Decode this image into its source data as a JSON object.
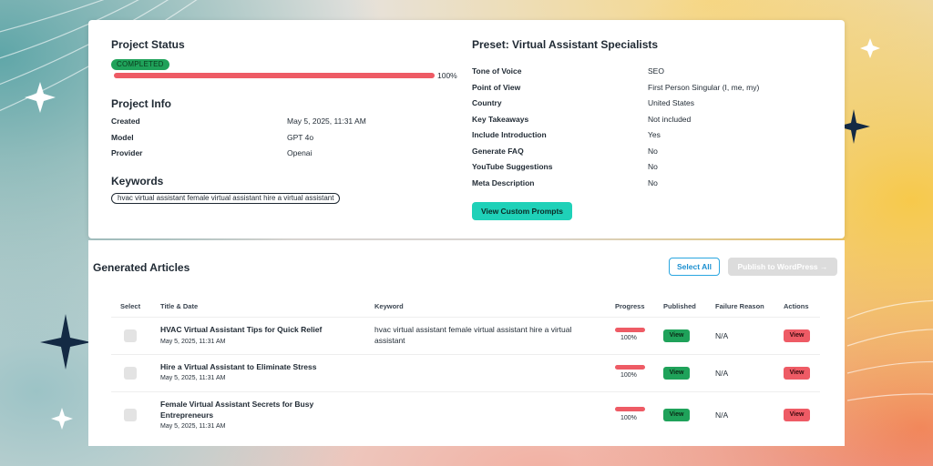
{
  "project_status": {
    "heading": "Project Status",
    "status_badge": "COMPLETED",
    "progress": 100,
    "progress_label": "100%"
  },
  "project_info": {
    "heading": "Project Info",
    "rows": [
      {
        "label": "Created",
        "value": "May 5, 2025, 11:31 AM"
      },
      {
        "label": "Model",
        "value": "GPT 4o"
      },
      {
        "label": "Provider",
        "value": "Openai"
      }
    ]
  },
  "keywords": {
    "heading": "Keywords",
    "items": [
      "hvac virtual assistant female virtual assistant hire a virtual assistant"
    ]
  },
  "preset": {
    "heading": "Preset: Virtual Assistant Specialists",
    "rows": [
      {
        "label": "Tone of Voice",
        "value": "SEO"
      },
      {
        "label": "Point of View",
        "value": "First Person Singular (I, me, my)"
      },
      {
        "label": "Country",
        "value": "United States"
      },
      {
        "label": "Key Takeaways",
        "value": "Not included"
      },
      {
        "label": "Include Introduction",
        "value": "Yes"
      },
      {
        "label": "Generate FAQ",
        "value": "No"
      },
      {
        "label": "YouTube Suggestions",
        "value": "No"
      },
      {
        "label": "Meta Description",
        "value": "No"
      }
    ],
    "custom_prompts_button": "View Custom Prompts"
  },
  "articles": {
    "heading": "Generated Articles",
    "select_all_button": "Select All",
    "publish_button": "Publish to WordPress →",
    "columns": [
      "Select",
      "Title & Date",
      "Keyword",
      "Progress",
      "Published",
      "Failure Reason",
      "Actions"
    ],
    "rows": [
      {
        "title": "HVAC Virtual Assistant Tips for Quick Relief",
        "date": "May 5, 2025, 11:31 AM",
        "keyword": "hvac virtual assistant female virtual assistant hire a virtual assistant",
        "progress": 100,
        "progress_label": "100%",
        "published_button": "View",
        "failure_reason": "N/A",
        "action_button": "View"
      },
      {
        "title": "Hire a Virtual Assistant to Eliminate Stress",
        "date": "May 5, 2025, 11:31 AM",
        "keyword": "",
        "progress": 100,
        "progress_label": "100%",
        "published_button": "View",
        "failure_reason": "N/A",
        "action_button": "View"
      },
      {
        "title": "Female Virtual Assistant Secrets for Busy Entrepreneurs",
        "date": "May 5, 2025, 11:31 AM",
        "keyword": "",
        "progress": 100,
        "progress_label": "100%",
        "published_button": "View",
        "failure_reason": "N/A",
        "action_button": "View"
      }
    ]
  },
  "colors": {
    "completed_green": "#1fa25a",
    "progress_red": "#ee5b65",
    "prompts_teal": "#1fd1b8",
    "select_all_blue": "#1b8fd0"
  }
}
